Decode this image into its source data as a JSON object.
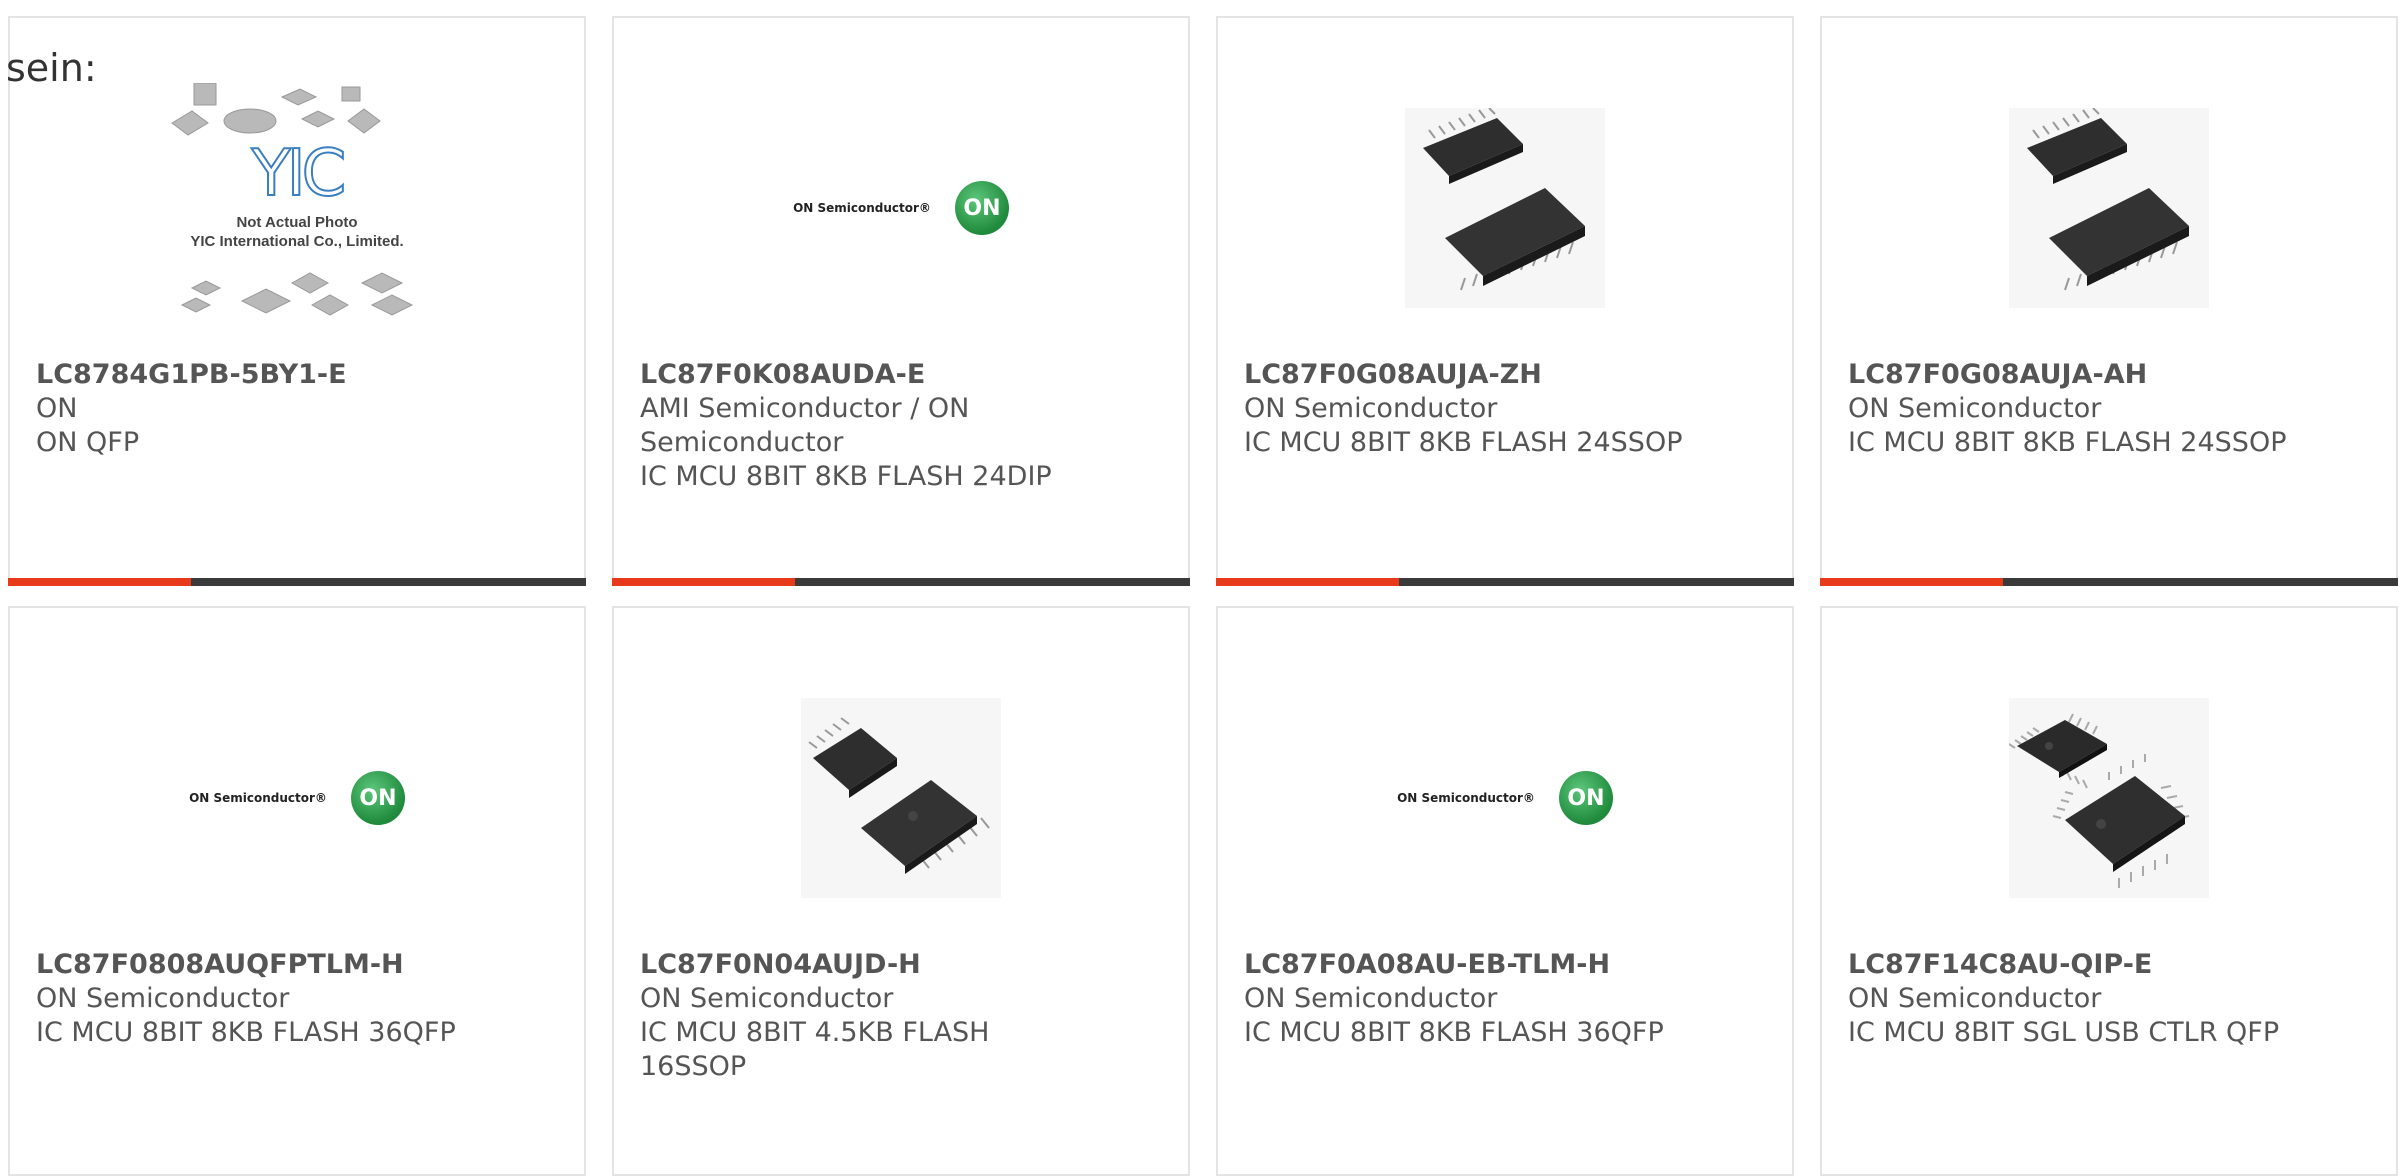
{
  "lead_text": "sein:",
  "colors": {
    "accent": "#e8391b",
    "bar": "#3a3a3a",
    "on_green": "#1f8a3c"
  },
  "products": [
    {
      "part": "LC8784G1PB-5BY1-E",
      "mfr": "ON",
      "desc": "ON QFP",
      "image": "yic-placeholder-image",
      "image_text": {
        "logo": "YIC",
        "line1": "Not Actual Photo",
        "line2": "YIC International Co., Limited."
      }
    },
    {
      "part": "LC87F0K08AUDA-E",
      "mfr": "AMI Semiconductor / ON Semiconductor",
      "desc": "IC MCU 8BIT 8KB FLASH 24DIP",
      "image": "on-semiconductor-logo"
    },
    {
      "part": "LC87F0G08AUJA-ZH",
      "mfr": "ON Semiconductor",
      "desc": "IC MCU 8BIT 8KB FLASH 24SSOP",
      "image": "ssop-chip-photo"
    },
    {
      "part": "LC87F0G08AUJA-AH",
      "mfr": "ON Semiconductor",
      "desc": "IC MCU 8BIT 8KB FLASH 24SSOP",
      "image": "ssop-chip-photo"
    },
    {
      "part": "LC87F0808AUQFPTLM-H",
      "mfr": "ON Semiconductor",
      "desc": "IC MCU 8BIT 8KB FLASH 36QFP",
      "image": "on-semiconductor-logo"
    },
    {
      "part": "LC87F0N04AUJD-H",
      "mfr": "ON Semiconductor",
      "desc": "IC MCU 8BIT 4.5KB FLASH 16SSOP",
      "image": "ssop-chip-photo"
    },
    {
      "part": "LC87F0A08AU-EB-TLM-H",
      "mfr": "ON Semiconductor",
      "desc": "IC MCU 8BIT 8KB FLASH 36QFP",
      "image": "on-semiconductor-logo"
    },
    {
      "part": "LC87F14C8AU-QIP-E",
      "mfr": "ON Semiconductor",
      "desc": "IC MCU 8BIT SGL USB CTLR QFP",
      "image": "qfp-chip-photo"
    }
  ],
  "on_logo": {
    "text": "ON Semiconductor®",
    "badge": "ON"
  }
}
